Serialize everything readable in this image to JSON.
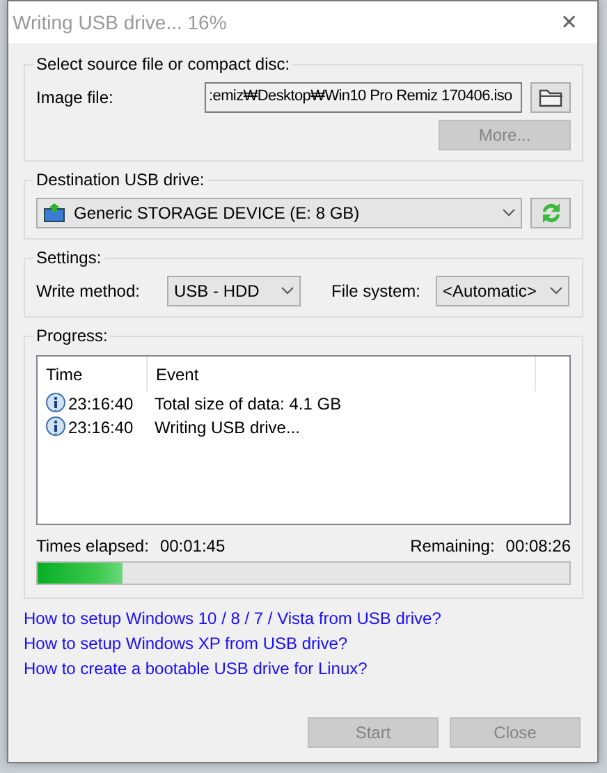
{
  "window": {
    "title": "Writing USB drive... 16%",
    "close": "✕"
  },
  "source": {
    "legend": "Select source file or compact disc:",
    "label": "Image file:",
    "value": ":emiz₩Desktop₩Win10 Pro Remiz 170406.iso",
    "more": {
      "label": "More...",
      "disabled": true
    }
  },
  "destination": {
    "legend": "Destination USB drive:",
    "value": "Generic STORAGE DEVICE (E: 8 GB)"
  },
  "settings": {
    "legend": "Settings:",
    "fields": [
      {
        "label": "Write method:",
        "value": "USB - HDD"
      },
      {
        "label": "File system:",
        "value": "<Automatic>"
      }
    ]
  },
  "progress": {
    "legend": "Progress:",
    "columns": [
      "Time",
      "Event"
    ],
    "rows": [
      {
        "time": "23:16:40",
        "event": "Total size of data: 4.1 GB"
      },
      {
        "time": "23:16:40",
        "event": "Writing USB drive..."
      }
    ],
    "elapsed_label": "Times elapsed:",
    "elapsed": "00:01:45",
    "remaining_label": "Remaining:",
    "remaining": "00:08:26",
    "level": 0.16
  },
  "links": [
    "How to setup Windows 10 / 8 / 7 / Vista from USB drive?",
    "How to setup Windows XP from USB drive?",
    "How to create a bootable USB drive for Linux?"
  ],
  "buttons": [
    {
      "label": "Start",
      "disabled": true
    },
    {
      "label": "Close",
      "disabled": true
    }
  ]
}
